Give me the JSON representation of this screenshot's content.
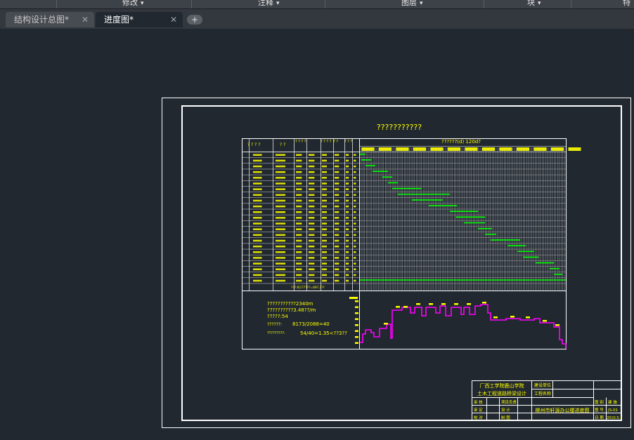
{
  "ribbon": {
    "items": [
      "修改",
      "注释",
      "图层",
      "块",
      "特"
    ]
  },
  "tabs": [
    {
      "label": "结构设计总图*",
      "active": false
    },
    {
      "label": "进度图*",
      "active": true
    }
  ],
  "newtab_symbol": "+",
  "drawing": {
    "title": "???????????",
    "header_left": [
      "? ? ? ?",
      "? ?",
      "? ? ? ?",
      "? ? ? ?",
      "? ?",
      "? ? ?"
    ],
    "header_right": "??????(d)   120d?",
    "info": {
      "line1": "???????????2340m",
      "line2": "??????????3.48??/m",
      "line3": "?????:54",
      "line4_label": "??????:",
      "line4_value": "8173/2088=40",
      "line5_label": "?????????:",
      "line5_value": "54/40=1.35<??3??"
    },
    "footer_row": "???:8177???=69?,???",
    "title_block": {
      "org1": "厂西工学院鹿山学院",
      "org2": "土木工程道路桥梁设计",
      "unit_label": "建设单位",
      "unit_value": "工程名称",
      "project": "柳州市轩源办公楼进度图",
      "rows_left": [
        [
          "审 核",
          "项目负责"
        ],
        [
          "审 定",
          "设 计"
        ],
        [
          "校 对",
          "制 图"
        ]
      ],
      "rows_right": [
        [
          "图 别",
          "建 施"
        ],
        [
          "图 号",
          "JS-01"
        ],
        [
          "日 期",
          "2010.5.1"
        ]
      ]
    }
  },
  "colors": {
    "background": "#212830",
    "frame": "#ffffff",
    "table": "#ffffff",
    "text": "#ffff00",
    "bar": "#00ff00",
    "curve": "#ff00ff"
  }
}
